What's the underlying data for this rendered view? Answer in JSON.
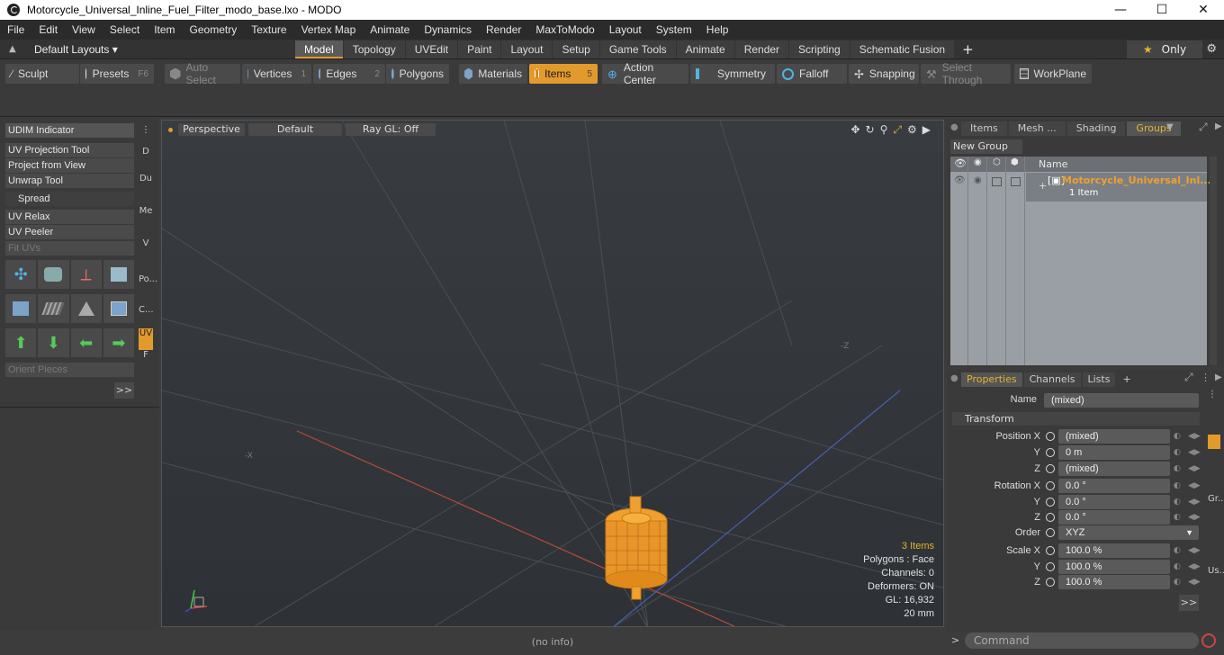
{
  "window": {
    "title": "Motorcycle_Universal_Inline_Fuel_Filter_modo_base.lxo - MODO",
    "minimize": "—",
    "maximize": "☐",
    "close": "✕"
  },
  "menu": [
    "File",
    "Edit",
    "View",
    "Select",
    "Item",
    "Geometry",
    "Texture",
    "Vertex Map",
    "Animate",
    "Dynamics",
    "Render",
    "MaxToModo",
    "Layout",
    "System",
    "Help"
  ],
  "layouts": {
    "selector": "Default Layouts ▾",
    "tabs": [
      "Model",
      "Topology",
      "UVEdit",
      "Paint",
      "Layout",
      "Setup",
      "Game Tools",
      "Animate",
      "Render",
      "Scripting",
      "Schematic Fusion"
    ],
    "active_tab": "Model",
    "add": "+",
    "only_label": "Only"
  },
  "toolbar": {
    "sculpt": "Sculpt",
    "presets": "Presets",
    "presets_key": "F6",
    "auto_select": "Auto Select",
    "vertices": "Vertices",
    "vertices_key": "1",
    "edges": "Edges",
    "edges_key": "2",
    "polygons": "Polygons",
    "materials": "Materials",
    "items": "Items",
    "items_key": "5",
    "action_center": "Action Center",
    "symmetry": "Symmetry",
    "falloff": "Falloff",
    "snapping": "Snapping",
    "select_through": "Select Through",
    "workplane": "WorkPlane"
  },
  "left_panel": {
    "udim": "UDIM Indicator",
    "uv_projection": "UV Projection Tool",
    "project_view": "Project from View",
    "unwrap": "Unwrap Tool",
    "spread": "Spread",
    "uv_relax": "UV Relax",
    "uv_peeler": "UV Peeler",
    "fit_uvs": "Fit UVs",
    "orient": "Orient Pieces",
    "more": ">>",
    "side_tabs": [
      "D",
      "Du",
      "Me",
      "V",
      "Po...",
      "C...",
      "UV",
      "F"
    ]
  },
  "viewport": {
    "view": "Perspective",
    "shading": "Default",
    "raygl": "Ray GL: Off",
    "info": {
      "items": "3 Items",
      "polygons": "Polygons : Face",
      "channels": "Channels: 0",
      "deformers": "Deformers: ON",
      "gl": "GL: 16,932",
      "scale": "20 mm"
    },
    "axis_label": "-Z",
    "axis_label_x": "-X"
  },
  "status": {
    "info": "(no info)"
  },
  "command": {
    "placeholder": "Command",
    "arrow": ">"
  },
  "right_top": {
    "tabs": [
      "Items",
      "Mesh ...",
      "Shading",
      "Groups"
    ],
    "active_tab": "Groups",
    "new_group": "New Group",
    "col_name": "Name",
    "group_name": "Motorcycle_Universal_Inl...",
    "group_sub": "1 Item"
  },
  "properties": {
    "tabs": [
      "Properties",
      "Channels",
      "Lists"
    ],
    "active_tab": "Properties",
    "add": "+",
    "name_label": "Name",
    "name_value": "(mixed)",
    "transform": "Transform",
    "position_x_label": "Position X",
    "position_x": "(mixed)",
    "position_y_label": "Y",
    "position_y": "0 m",
    "position_z_label": "Z",
    "position_z": "(mixed)",
    "rotation_x_label": "Rotation X",
    "rotation_x": "0.0 °",
    "rotation_y_label": "Y",
    "rotation_y": "0.0 °",
    "rotation_z_label": "Z",
    "rotation_z": "0.0 °",
    "order_label": "Order",
    "order": "XYZ",
    "scale_x_label": "Scale X",
    "scale_x": "100.0 %",
    "scale_y_label": "Y",
    "scale_y": "100.0 %",
    "scale_z_label": "Z",
    "scale_z": "100.0 %",
    "more": ">>",
    "side_tabs": [
      "Gr...",
      "Us..."
    ]
  },
  "colors": {
    "accent": "#e39a2c",
    "selected_mesh": "#f0a030",
    "panel": "#3a3a3a"
  }
}
